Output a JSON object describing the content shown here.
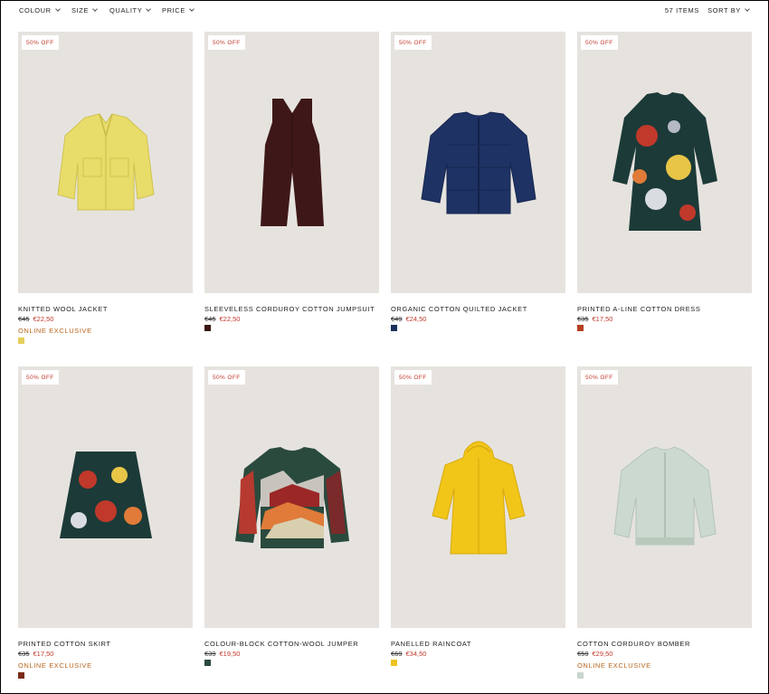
{
  "filters": {
    "colour": "COLOUR",
    "size": "SIZE",
    "quality": "QUALITY",
    "price": "PRICE",
    "items_count": "57 ITEMS",
    "sort": "SORT BY"
  },
  "products": [
    {
      "badge": "50% OFF",
      "name": "KNITTED WOOL JACKET",
      "old_price": "€45",
      "new_price": "€22,50",
      "exclusive": "ONLINE EXCLUSIVE",
      "swatch": "#e3cf5a",
      "icon": "yellow-jacket-icon"
    },
    {
      "badge": "50% OFF",
      "name": "SLEEVELESS CORDUROY COTTON JUMPSUIT",
      "old_price": "€45",
      "new_price": "€22,50",
      "exclusive": "",
      "swatch": "#3b1616",
      "icon": "brown-jumpsuit-icon"
    },
    {
      "badge": "50% OFF",
      "name": "ORGANIC COTTON QUILTED JACKET",
      "old_price": "€49",
      "new_price": "€24,50",
      "exclusive": "",
      "swatch": "#1e2f5c",
      "icon": "navy-quilted-jacket-icon"
    },
    {
      "badge": "50% OFF",
      "name": "PRINTED A-LINE COTTON DRESS",
      "old_price": "€35",
      "new_price": "€17,50",
      "exclusive": "",
      "swatch": "#b5401f",
      "icon": "printed-dress-icon"
    },
    {
      "badge": "50% OFF",
      "name": "PRINTED COTTON SKIRT",
      "old_price": "€35",
      "new_price": "€17,50",
      "exclusive": "ONLINE EXCLUSIVE",
      "swatch": "#7a2a16",
      "icon": "printed-skirt-icon"
    },
    {
      "badge": "50% OFF",
      "name": "COLOUR-BLOCK COTTON-WOOL JUMPER",
      "old_price": "€39",
      "new_price": "€19,50",
      "exclusive": "",
      "swatch": "#2b4a3e",
      "icon": "colour-block-jumper-icon"
    },
    {
      "badge": "50% OFF",
      "name": "PANELLED RAINCOAT",
      "old_price": "€69",
      "new_price": "€34,50",
      "exclusive": "",
      "swatch": "#f0c21e",
      "icon": "yellow-raincoat-icon"
    },
    {
      "badge": "50% OFF",
      "name": "COTTON CORDUROY BOMBER",
      "old_price": "€59",
      "new_price": "€29,50",
      "exclusive": "ONLINE EXCLUSIVE",
      "swatch": "#c9d6cc",
      "icon": "mint-bomber-icon"
    }
  ]
}
